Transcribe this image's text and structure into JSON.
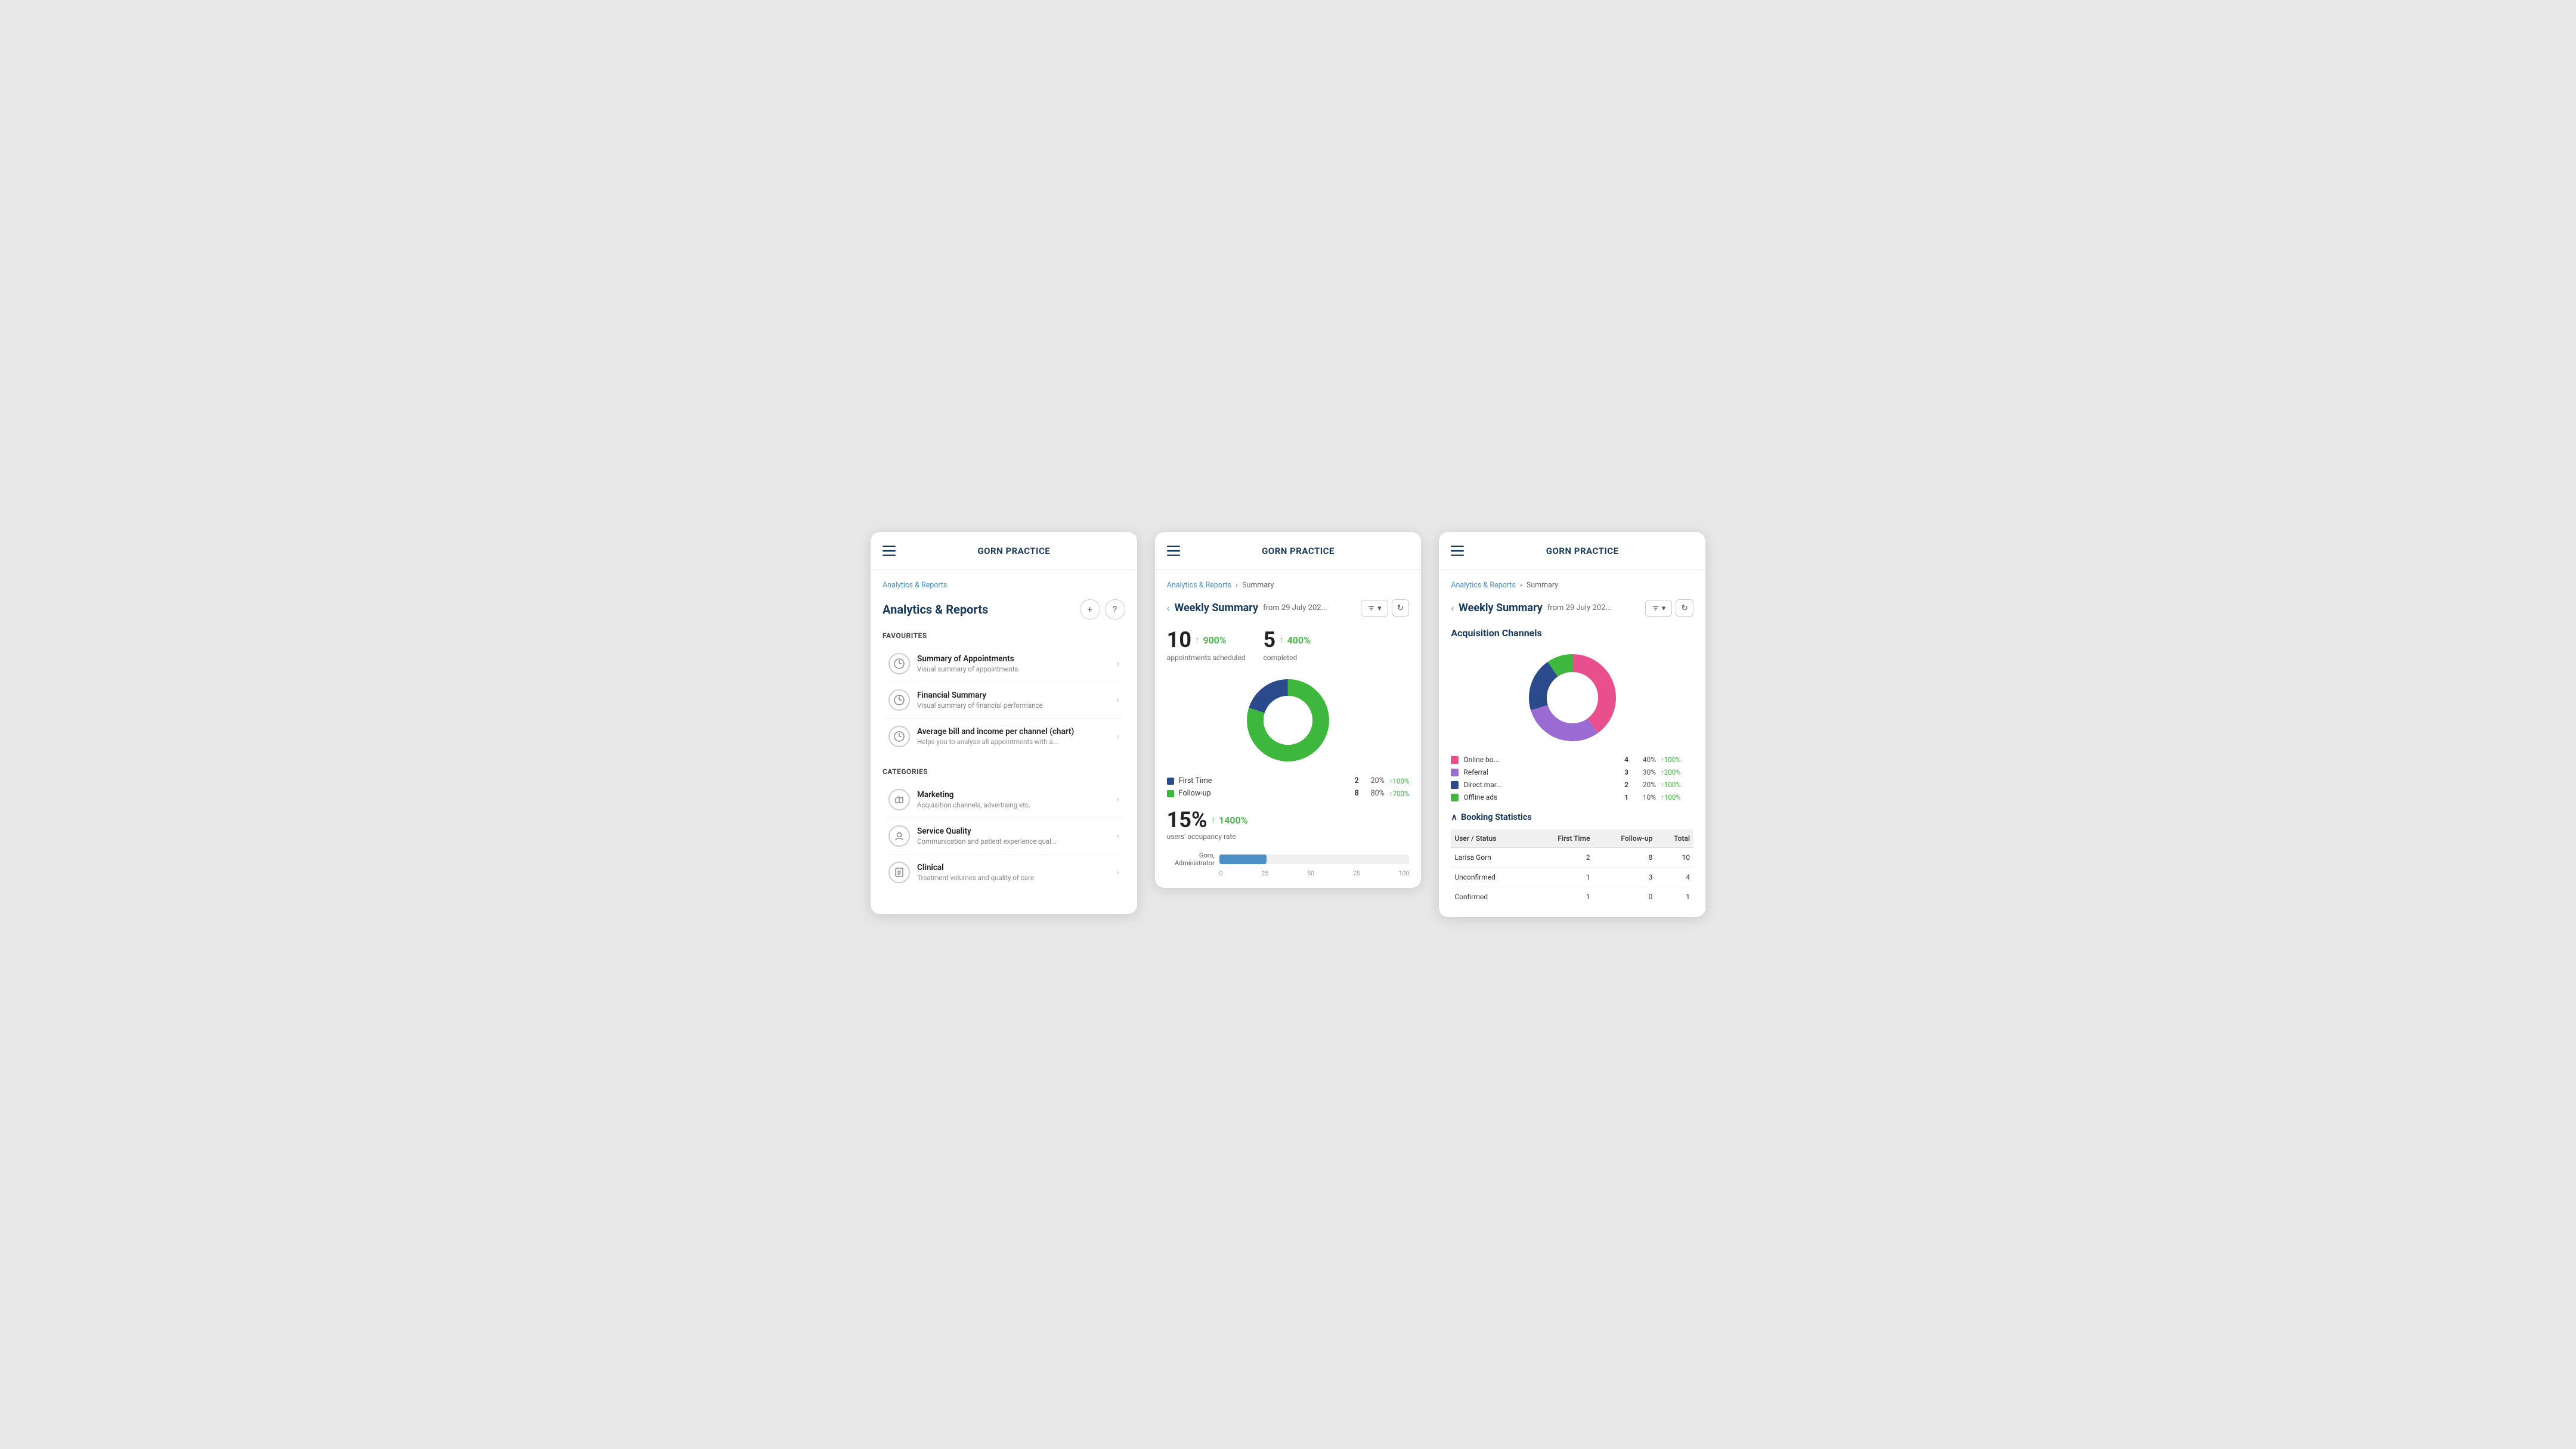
{
  "app": {
    "name": "GORN PRACTICE"
  },
  "panel1": {
    "breadcrumb": "Analytics & Reports",
    "heading": "Analytics & Reports",
    "add_label": "+",
    "help_label": "?",
    "favourites_label": "FAVOURITES",
    "favourites": [
      {
        "id": "summary-appointments",
        "title": "Summary of Appointments",
        "subtitle": "Visual summary of appointments",
        "icon": "📊"
      },
      {
        "id": "financial-summary",
        "title": "Financial Summary",
        "subtitle": "Visual summary of financial performance",
        "icon": "📊"
      },
      {
        "id": "avg-bill",
        "title": "Average bill and income per channel (chart)",
        "subtitle": "Helps you to analyse all appointments with a...",
        "icon": "📊"
      }
    ],
    "categories_label": "CATEGORIES",
    "categories": [
      {
        "id": "marketing",
        "title": "Marketing",
        "subtitle": "Acquisition channels, advertising etc.",
        "icon": "📣"
      },
      {
        "id": "service-quality",
        "title": "Service Quality",
        "subtitle": "Communication and patient experience qual...",
        "icon": "🎧"
      },
      {
        "id": "clinical",
        "title": "Clinical",
        "subtitle": "Treatment volumes and quality of care",
        "icon": "📋"
      }
    ]
  },
  "panel2": {
    "breadcrumb_part1": "Analytics & Reports",
    "breadcrumb_sep": ">",
    "breadcrumb_part2": "Summary",
    "back_label": "<",
    "weekly_title": "Weekly Summary",
    "weekly_date": "from 29 July 202...",
    "stats": [
      {
        "number": "10",
        "pct": "900%",
        "label": "appointments scheduled"
      },
      {
        "number": "5",
        "pct": "400%",
        "label": "completed"
      }
    ],
    "donut": {
      "segments": [
        {
          "label": "First Time",
          "color": "#2a4a8c",
          "pct": 20,
          "count": 2,
          "change": "↑100%",
          "degrees": 72
        },
        {
          "label": "Follow-up",
          "color": "#3db83d",
          "pct": 80,
          "count": 8,
          "change": "↑700%",
          "degrees": 288
        }
      ]
    },
    "occupancy_pct": "15%",
    "occupancy_change": "1400%",
    "occupancy_label": "users' occupancy rate",
    "bar_user": "Gorn, Administrator",
    "bar_fill_pct": 25,
    "bar_axis": [
      "0",
      "25",
      "50",
      "75",
      "100"
    ]
  },
  "panel3": {
    "breadcrumb_part1": "Analytics & Reports",
    "breadcrumb_sep": ">",
    "breadcrumb_part2": "Summary",
    "back_label": "<",
    "weekly_title": "Weekly Summary",
    "weekly_date": "from 29 July 202...",
    "acq_heading": "Acquisition Channels",
    "acq_channels": [
      {
        "label": "Online bo...",
        "color": "#e84f8c",
        "count": 4,
        "pct": "40%",
        "change": "↑100%"
      },
      {
        "label": "Referral",
        "color": "#9b6bd4",
        "count": 3,
        "pct": "30%",
        "change": "↑200%"
      },
      {
        "label": "Direct mar...",
        "color": "#2a4a8c",
        "count": 2,
        "pct": "20%",
        "change": "↑100%"
      },
      {
        "label": "Offline ads",
        "color": "#3db83d",
        "count": 1,
        "pct": "10%",
        "change": "↑100%"
      }
    ],
    "booking_stats_label": "Booking Statistics",
    "table_headers": [
      "User / Status",
      "First Time",
      "Follow-up",
      "Total"
    ],
    "table_rows": [
      {
        "user": "Larisa Gorn",
        "first_time": 2,
        "follow_up": 8,
        "total": 10
      },
      {
        "user": "Unconfirmed",
        "first_time": 1,
        "follow_up": 3,
        "total": 4
      },
      {
        "user": "Confirmed",
        "first_time": 1,
        "follow_up": 0,
        "total": 1
      }
    ]
  }
}
